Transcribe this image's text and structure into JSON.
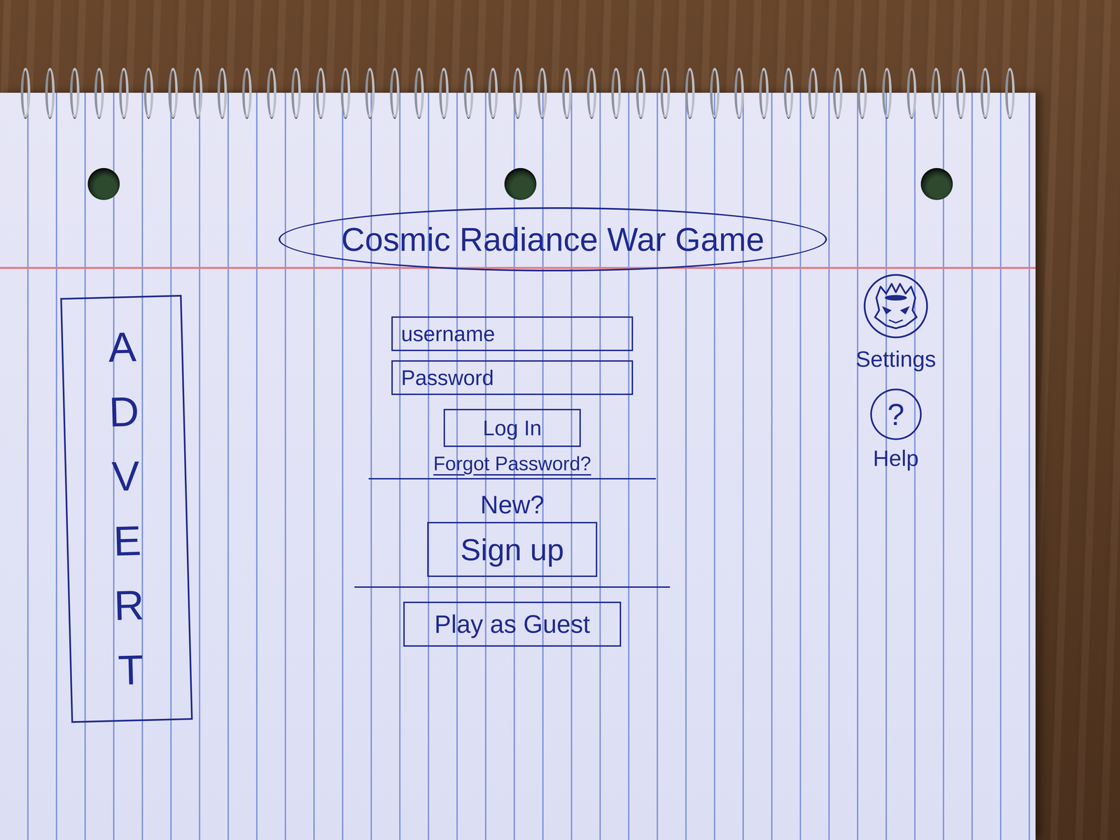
{
  "title": "Cosmic Radiance War Game",
  "advert": {
    "label": "ADVERT"
  },
  "login": {
    "fields": [
      {
        "name": "username",
        "placeholder": "username",
        "kind": "text"
      },
      {
        "name": "password",
        "placeholder": "Password",
        "kind": "password"
      }
    ],
    "submit": "Log In",
    "forgot_link": "Forgot Password?"
  },
  "signup": {
    "prompt": "New?",
    "button": "Sign up"
  },
  "guest": {
    "button": "Play as Guest"
  },
  "side_menu": [
    {
      "label": "Settings",
      "kind": "drawing"
    },
    {
      "label": "Help",
      "kind": "glyph",
      "glyph": "?"
    }
  ]
}
